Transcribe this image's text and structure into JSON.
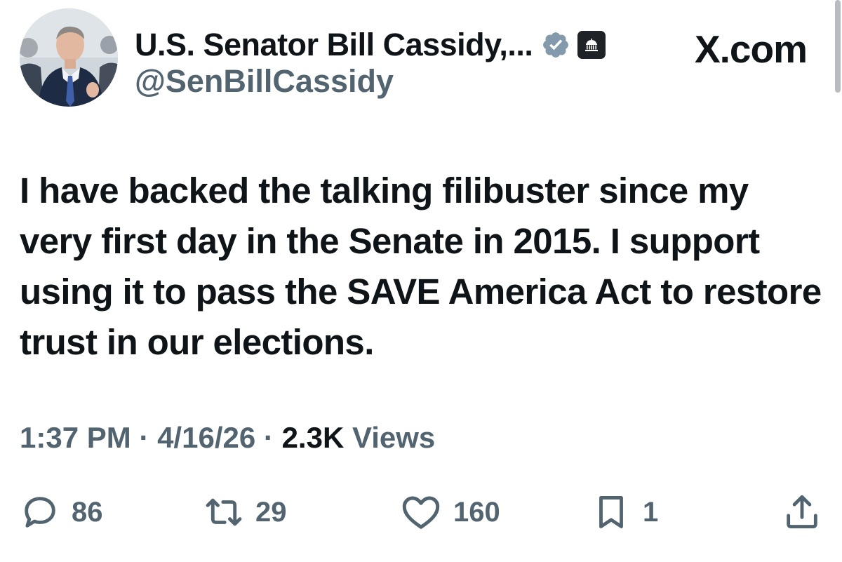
{
  "profile": {
    "display_name": "U.S. Senator Bill Cassidy,...",
    "handle": "@SenBillCassidy"
  },
  "brand": "X.com",
  "tweet": {
    "text": "I have backed the talking filibuster since my very first day in the Senate in 2015. I support using it to pass the SAVE America Act to restore trust in our elections."
  },
  "meta": {
    "time": "1:37 PM",
    "separator": "·",
    "date": "4/16/26",
    "views_count": "2.3K",
    "views_label": "Views"
  },
  "actions": {
    "replies": "86",
    "reposts": "29",
    "likes": "160",
    "bookmarks": "1"
  },
  "colors": {
    "verified_badge": "#829aab",
    "text_primary": "#0f1419",
    "text_secondary": "#536471"
  },
  "icons": {
    "verified": "verified-badge-icon",
    "affiliation": "capitol-building-icon",
    "reply": "reply-icon",
    "repost": "repost-icon",
    "like": "heart-icon",
    "bookmark": "bookmark-icon",
    "share": "share-icon"
  }
}
